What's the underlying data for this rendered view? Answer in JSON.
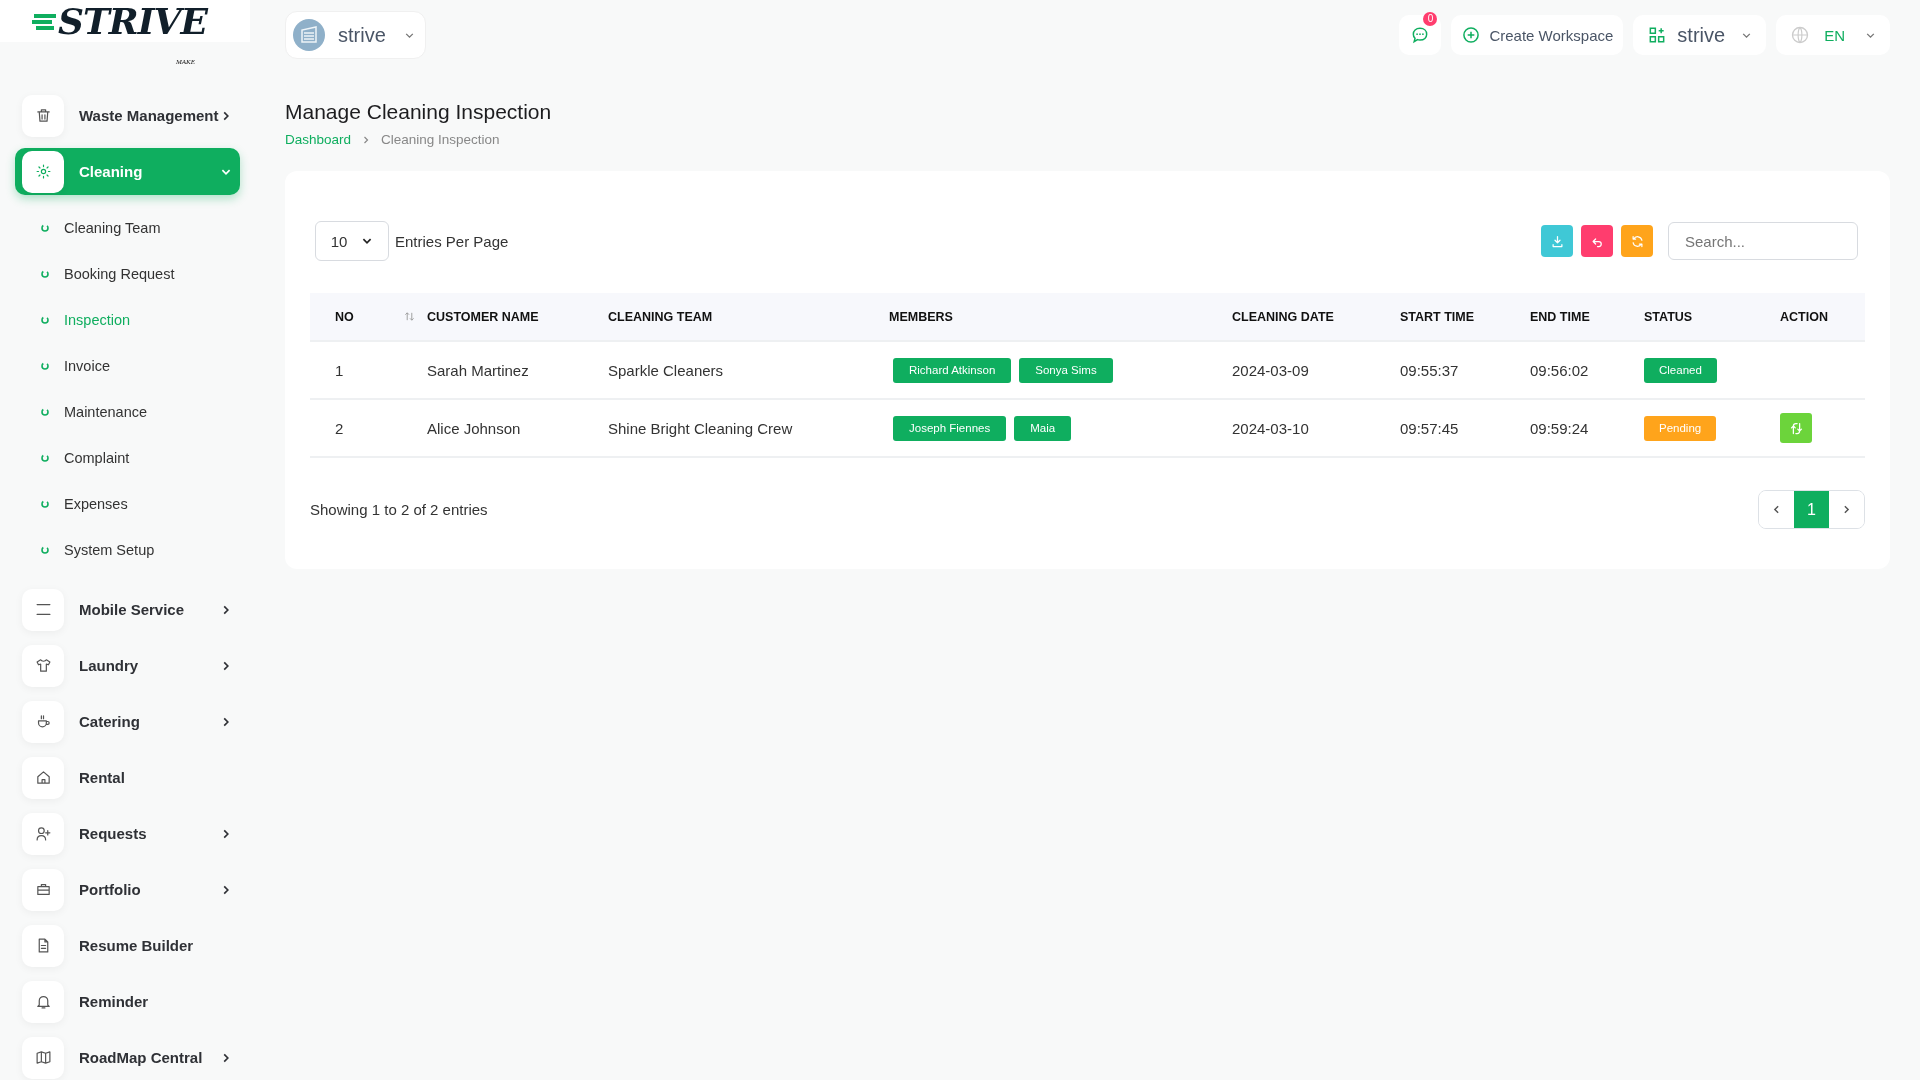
{
  "logo": {
    "name": "STRIVE",
    "tagline": "MAKE"
  },
  "header": {
    "workspace": {
      "label": "strive"
    },
    "notifications": {
      "count": "0"
    },
    "create_button": {
      "label": "Create Workspace"
    },
    "workspace_menu": {
      "label": "strive"
    },
    "language": {
      "label": "EN"
    }
  },
  "sidebar": {
    "items": [
      {
        "label": "Waste Management",
        "has_submenu": true,
        "expanded": false,
        "selected": false
      },
      {
        "label": "Cleaning",
        "has_submenu": true,
        "expanded": true,
        "selected": true,
        "children": [
          {
            "label": "Cleaning Team",
            "selected": false
          },
          {
            "label": "Booking Request",
            "selected": false
          },
          {
            "label": "Inspection",
            "selected": true
          },
          {
            "label": "Invoice",
            "selected": false
          },
          {
            "label": "Maintenance",
            "selected": false
          },
          {
            "label": "Complaint",
            "selected": false
          },
          {
            "label": "Expenses",
            "selected": false
          },
          {
            "label": "System Setup",
            "selected": false
          }
        ]
      },
      {
        "label": "Mobile Service",
        "has_submenu": true,
        "expanded": false,
        "selected": false
      },
      {
        "label": "Laundry",
        "has_submenu": true,
        "expanded": false,
        "selected": false
      },
      {
        "label": "Catering",
        "has_submenu": true,
        "expanded": false,
        "selected": false
      },
      {
        "label": "Rental",
        "has_submenu": false,
        "selected": false
      },
      {
        "label": "Requests",
        "has_submenu": true,
        "expanded": false,
        "selected": false
      },
      {
        "label": "Portfolio",
        "has_submenu": true,
        "expanded": false,
        "selected": false
      },
      {
        "label": "Resume Builder",
        "has_submenu": false,
        "selected": false
      },
      {
        "label": "Reminder",
        "has_submenu": false,
        "selected": false
      },
      {
        "label": "RoadMap Central",
        "has_submenu": true,
        "expanded": false,
        "selected": false
      }
    ]
  },
  "page": {
    "title": "Manage Cleaning Inspection",
    "breadcrumb": [
      {
        "label": "Dashboard",
        "kind": "link"
      },
      {
        "label": "Cleaning Inspection",
        "kind": "current"
      }
    ]
  },
  "controls": {
    "entries": {
      "value": "10",
      "label": "Entries Per Page"
    },
    "tools": [
      {
        "kind": "download"
      },
      {
        "kind": "undo"
      },
      {
        "kind": "refresh"
      }
    ],
    "search": {
      "placeholder": "Search..."
    }
  },
  "table": {
    "columns": [
      {
        "label": "NO",
        "sortable": true
      },
      {
        "label": "CUSTOMER NAME",
        "sortable": false
      },
      {
        "label": "CLEANING TEAM",
        "sortable": false
      },
      {
        "label": "MEMBERS",
        "sortable": false
      },
      {
        "label": "CLEANING DATE",
        "sortable": false
      },
      {
        "label": "START TIME",
        "sortable": false
      },
      {
        "label": "END TIME",
        "sortable": false
      },
      {
        "label": "STATUS",
        "sortable": false
      },
      {
        "label": "ACTION",
        "sortable": false
      }
    ],
    "rows": [
      {
        "no": "1",
        "customer": "Sarah Martinez",
        "team": "Sparkle Cleaners",
        "members": [
          "Richard Atkinson",
          "Sonya Sims"
        ],
        "date": "2024-03-09",
        "start": "09:55:37",
        "end": "09:56:02",
        "status": {
          "label": "Cleaned",
          "kind": "cleaned"
        },
        "action_button": false
      },
      {
        "no": "2",
        "customer": "Alice Johnson",
        "team": "Shine Bright Cleaning Crew",
        "members": [
          "Joseph Fiennes",
          "Maia"
        ],
        "date": "2024-03-10",
        "start": "09:57:45",
        "end": "09:59:24",
        "status": {
          "label": "Pending",
          "kind": "pending"
        },
        "action_button": true
      }
    ]
  },
  "footer": {
    "summary": "Showing 1 to 2 of 2 entries",
    "pages": [
      {
        "label": "1",
        "selected": true
      }
    ]
  }
}
